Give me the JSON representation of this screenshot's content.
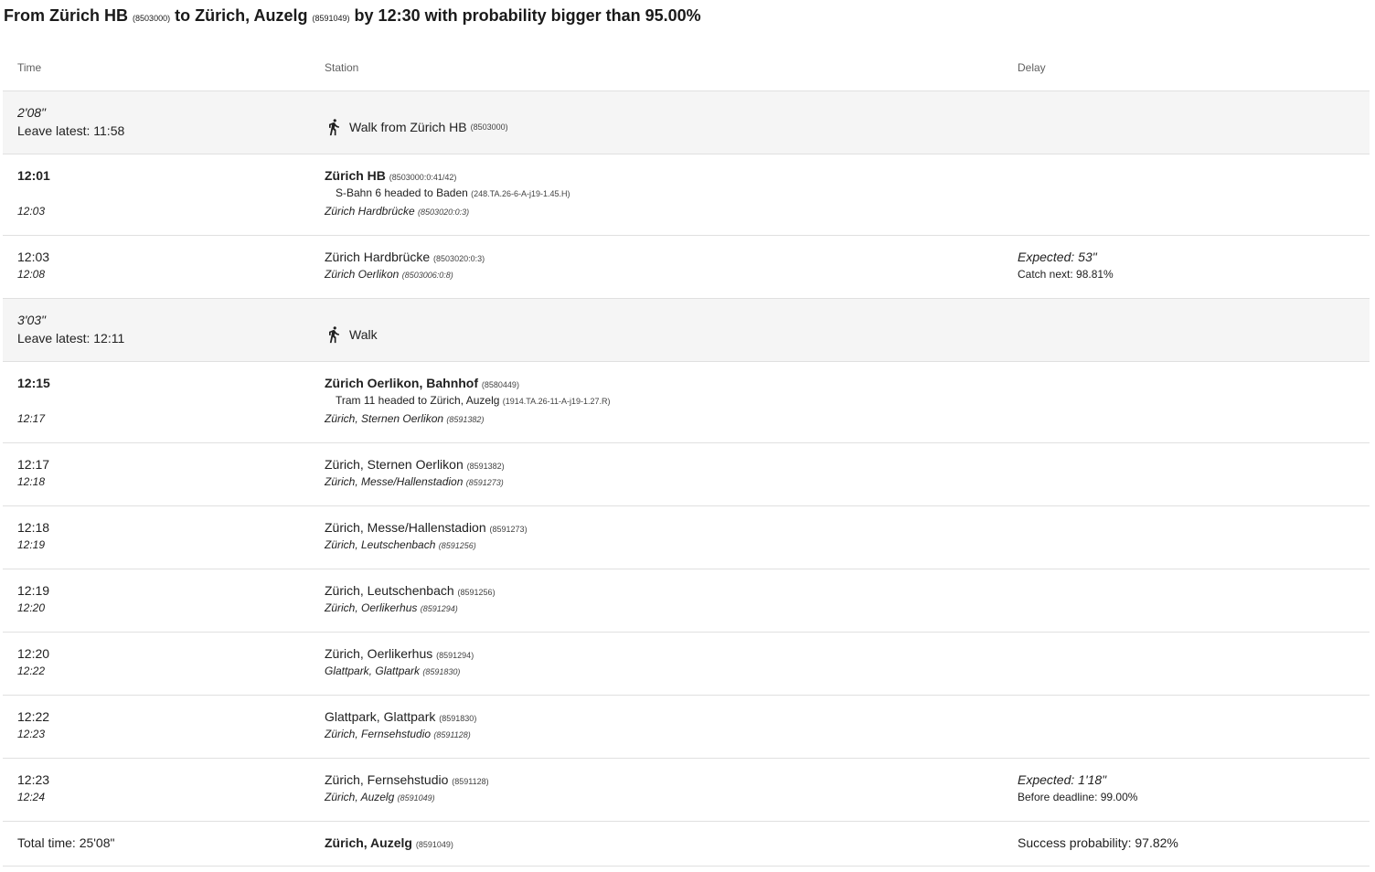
{
  "title": {
    "from_label": "From",
    "origin": "Zürich HB",
    "origin_code": "(8503000)",
    "to_label": "to",
    "destination": "Zürich, Auzelg",
    "destination_code": "(8591049)",
    "suffix": "by 12:30 with probability bigger than 95.00%"
  },
  "columns": {
    "time": "Time",
    "station": "Station",
    "delay": "Delay"
  },
  "walk1": {
    "duration": "2'08\"",
    "leave_latest": "Leave latest: 11:58",
    "label": "Walk from Zürich HB",
    "code": "(8503000)",
    "icon": "walk-icon"
  },
  "ride1": {
    "depart": "12:01",
    "arrive": "12:03",
    "station": "Zürich HB",
    "station_code": "(8503000:0:41/42)",
    "route": "S-Bahn 6 headed to Baden",
    "route_code": "(248.TA.26-6-A-j19-1.45.H)",
    "to_station": "Zürich Hardbrücke",
    "to_code": "(8503020:0:3)"
  },
  "seg1": {
    "depart": "12:03",
    "arrive": "12:08",
    "station": "Zürich Hardbrücke",
    "station_code": "(8503020:0:3)",
    "to_station": "Zürich Oerlikon",
    "to_code": "(8503006:0:8)",
    "expected": "Expected: 53\"",
    "catch_next": "Catch next: 98.81%"
  },
  "walk2": {
    "duration": "3'03\"",
    "leave_latest": "Leave latest: 12:11",
    "label": "Walk",
    "icon": "walk-icon"
  },
  "ride2": {
    "depart": "12:15",
    "arrive": "12:17",
    "station": "Zürich Oerlikon, Bahnhof",
    "station_code": "(8580449)",
    "route": "Tram 11 headed to Zürich, Auzelg",
    "route_code": "(1914.TA.26-11-A-j19-1.27.R)",
    "to_station": "Zürich, Sternen Oerlikon",
    "to_code": "(8591382)"
  },
  "stops": [
    {
      "depart": "12:17",
      "arrive": "12:18",
      "station": "Zürich, Sternen Oerlikon",
      "station_code": "(8591382)",
      "to_station": "Zürich, Messe/Hallenstadion",
      "to_code": "(8591273)"
    },
    {
      "depart": "12:18",
      "arrive": "12:19",
      "station": "Zürich, Messe/Hallenstadion",
      "station_code": "(8591273)",
      "to_station": "Zürich, Leutschenbach",
      "to_code": "(8591256)"
    },
    {
      "depart": "12:19",
      "arrive": "12:20",
      "station": "Zürich, Leutschenbach",
      "station_code": "(8591256)",
      "to_station": "Zürich, Oerlikerhus",
      "to_code": "(8591294)"
    },
    {
      "depart": "12:20",
      "arrive": "12:22",
      "station": "Zürich, Oerlikerhus",
      "station_code": "(8591294)",
      "to_station": "Glattpark, Glattpark",
      "to_code": "(8591830)"
    },
    {
      "depart": "12:22",
      "arrive": "12:23",
      "station": "Glattpark, Glattpark",
      "station_code": "(8591830)",
      "to_station": "Zürich, Fernsehstudio",
      "to_code": "(8591128)"
    },
    {
      "depart": "12:23",
      "arrive": "12:24",
      "station": "Zürich, Fernsehstudio",
      "station_code": "(8591128)",
      "to_station": "Zürich, Auzelg",
      "to_code": "(8591049)",
      "expected": "Expected: 1'18\"",
      "before_deadline": "Before deadline: 99.00%"
    }
  ],
  "total": {
    "time": "Total time: 25'08\"",
    "station": "Zürich, Auzelg",
    "station_code": "(8591049)",
    "success": "Success probability: 97.82%"
  }
}
